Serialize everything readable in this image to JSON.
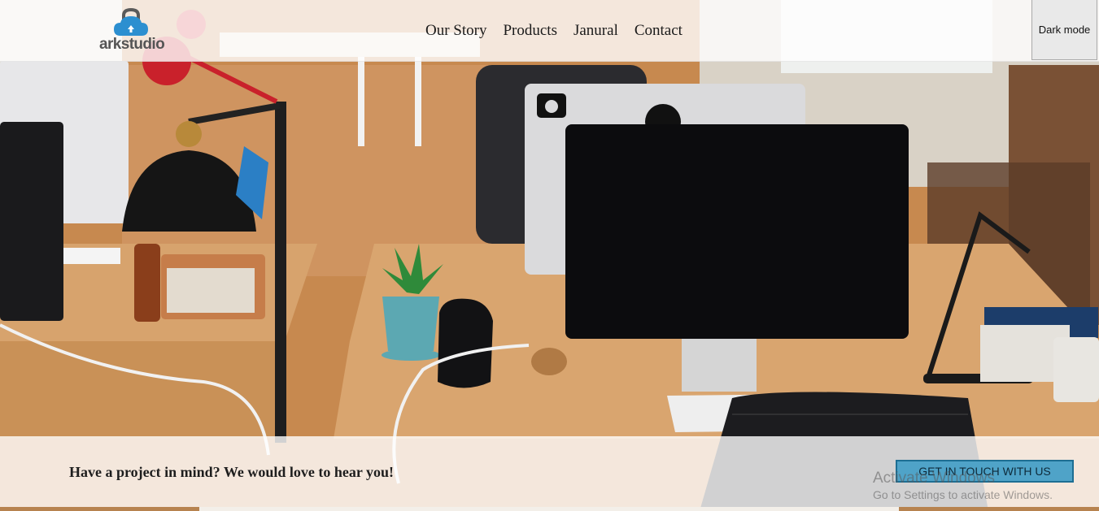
{
  "header": {
    "logo_text": "arkstudio",
    "nav": [
      "Our Story",
      "Products",
      "Janural",
      "Contact"
    ],
    "dark_mode_label": "Dark mode"
  },
  "cta": {
    "message": "Have a project in mind? We would love to hear you!",
    "button_label": "GET IN TOUCH WITH US"
  },
  "watermark": {
    "title": "Activate Windows",
    "subtitle": "Go to Settings to activate Windows."
  },
  "colors": {
    "accent_button": "#4fa3c8",
    "accent_border": "#1d6e93",
    "logo_cloud": "#2c8fd0"
  }
}
